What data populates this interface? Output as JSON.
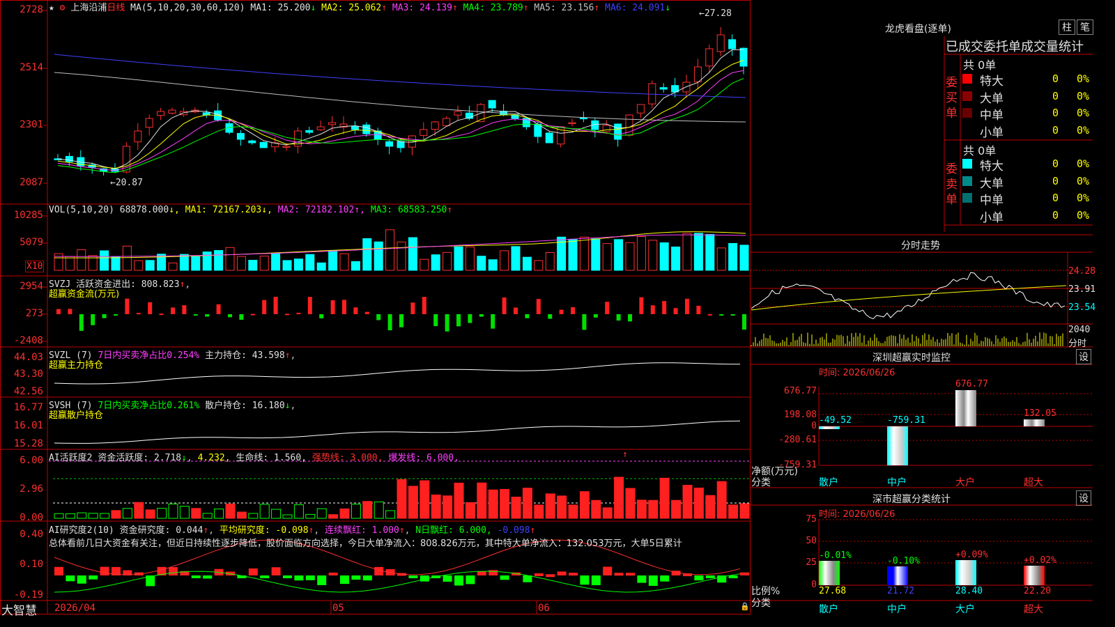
{
  "main": {
    "stock_name": "上海沿浦",
    "period": "日线",
    "ma_header": "MA(5,10,20,30,60,120)",
    "ma": [
      {
        "label": "MA1: 25.200",
        "arrow": "↓",
        "color": "#e0e0e0"
      },
      {
        "label": "MA2: 25.062",
        "arrow": "↑",
        "color": "#ffff00"
      },
      {
        "label": "MA3: 24.139",
        "arrow": "↑",
        "color": "#ff40ff"
      },
      {
        "label": "MA4: 23.789",
        "arrow": "↑",
        "color": "#00ff00"
      },
      {
        "label": "MA5: 23.156",
        "arrow": "↑",
        "color": "#c0c0c0"
      },
      {
        "label": "MA6: 24.091",
        "arrow": "↓",
        "color": "#4040ff"
      }
    ],
    "y_ticks": [
      "2728",
      "2514",
      "2301",
      "2087"
    ],
    "high_label": "27.28",
    "low_label": "20.87"
  },
  "vol": {
    "header": "VOL(5,10,20)",
    "value": "68878.000",
    "ma1": "MA1: 72167.203",
    "ma2": "MA2: 72182.102",
    "ma3": "MA3: 68583.250",
    "y_ticks": [
      "10285",
      "5079"
    ],
    "unit": "X10"
  },
  "svzj": {
    "line1": "SVZJ  活跃资金进出: 808.823",
    "line2": "超赢资金流(万元)",
    "y_ticks": [
      "2954",
      "273",
      "-2408"
    ]
  },
  "svzl": {
    "name": "SVZL  (7)",
    "ratio": "7日内买卖净占比0.254%",
    "hold": "主力持仓: 43.598",
    "line2": "超赢主力持仓",
    "y_ticks": [
      "44.03",
      "43.30",
      "42.56"
    ]
  },
  "svsh": {
    "name": "SVSH  (7)",
    "ratio": "7日内买卖净占比0.261%",
    "hold": "散户持仓: 16.180",
    "line2": "超赢散户持仓",
    "y_ticks": [
      "16.77",
      "16.01",
      "15.28"
    ]
  },
  "ai_active": {
    "name": "AI活跃度2",
    "a": "资金活跃度: 2.718",
    "b": "4.232,",
    "c": "生命线: 1.560,",
    "d": "强势线: 3.000,",
    "e": "爆发线: 6.000,",
    "y_ticks": [
      "6.00",
      "2.96",
      "0.00"
    ]
  },
  "ai_research": {
    "name": "AI研究度2(10)",
    "a": "资金研究度: 0.044",
    "b": "平均研究度: -0.098",
    "c": "连续飘红: 1.000",
    "d": "N日飘红: 6.000,",
    "e": "-0.098",
    "summary": "总体看前几日大资金有关注，但近日持续性逐步降低，股价面临方向选择，今日大单净流入：808.826万元，其中特大单净流入：132.053万元，大单5日累计",
    "y_ticks": [
      "0.40",
      "0.10",
      "-0.19"
    ]
  },
  "bottom": {
    "brand": "大智慧",
    "dates": [
      "2026/04",
      "05",
      "06"
    ]
  },
  "right": {
    "longhu_title": "龙虎看盘(逐单)",
    "btn_zhu": "柱",
    "btn_bi": "笔",
    "stat_header": "已成交委托单成交量统计",
    "buy": {
      "side": "委买单",
      "total": "共 0单",
      "rows": [
        {
          "label": "特大",
          "color": "#ff0000",
          "count": "0",
          "pct": "0%"
        },
        {
          "label": "大单",
          "color": "#8b0000",
          "count": "0",
          "pct": "0%"
        },
        {
          "label": "中单",
          "color": "#6a0000",
          "count": "0",
          "pct": "0%"
        },
        {
          "label": "小单",
          "color": "#000000",
          "count": "0",
          "pct": "0%"
        }
      ]
    },
    "sell": {
      "side": "委卖单",
      "total": "共 0单",
      "rows": [
        {
          "label": "特大",
          "color": "#00ffff",
          "count": "0",
          "pct": "0%"
        },
        {
          "label": "大单",
          "color": "#008b8b",
          "count": "0",
          "pct": "0%"
        },
        {
          "label": "中单",
          "color": "#007070",
          "count": "0",
          "pct": "0%"
        },
        {
          "label": "小单",
          "color": "#000000",
          "count": "0",
          "pct": "0%"
        }
      ]
    },
    "fenshi": {
      "title": "分时走势",
      "prices": [
        "24.28",
        "23.91",
        "23.54"
      ],
      "vol": "2040",
      "unit": "分时"
    },
    "sz_monitor": {
      "title": "深圳超赢实时监控",
      "btn": "设",
      "time": "时间: 2026/06/26",
      "y_ticks": [
        "676.77",
        "198.08",
        "0",
        "-280.61",
        "-759.31"
      ],
      "y_label": "净额(万元)",
      "x_label": "分类",
      "values": [
        "-49.52",
        "-759.31",
        "676.77",
        "132.05"
      ],
      "cats": [
        "散户",
        "中户",
        "大户",
        "超大"
      ]
    },
    "sz_class": {
      "title": "深市超赢分类统计",
      "btn": "设",
      "time": "时间: 2026/06/26",
      "y_ticks": [
        "75",
        "50",
        "25",
        "0"
      ],
      "y_label": "比例%",
      "x_label": "分类",
      "top_values": [
        "-0.01%",
        "-0.10%",
        "+0.09%",
        "+0.02%"
      ],
      "bottom_values": [
        "27.68",
        "21.72",
        "28.40",
        "22.20"
      ],
      "cats": [
        "散户",
        "中户",
        "大户",
        "超大"
      ]
    }
  }
}
